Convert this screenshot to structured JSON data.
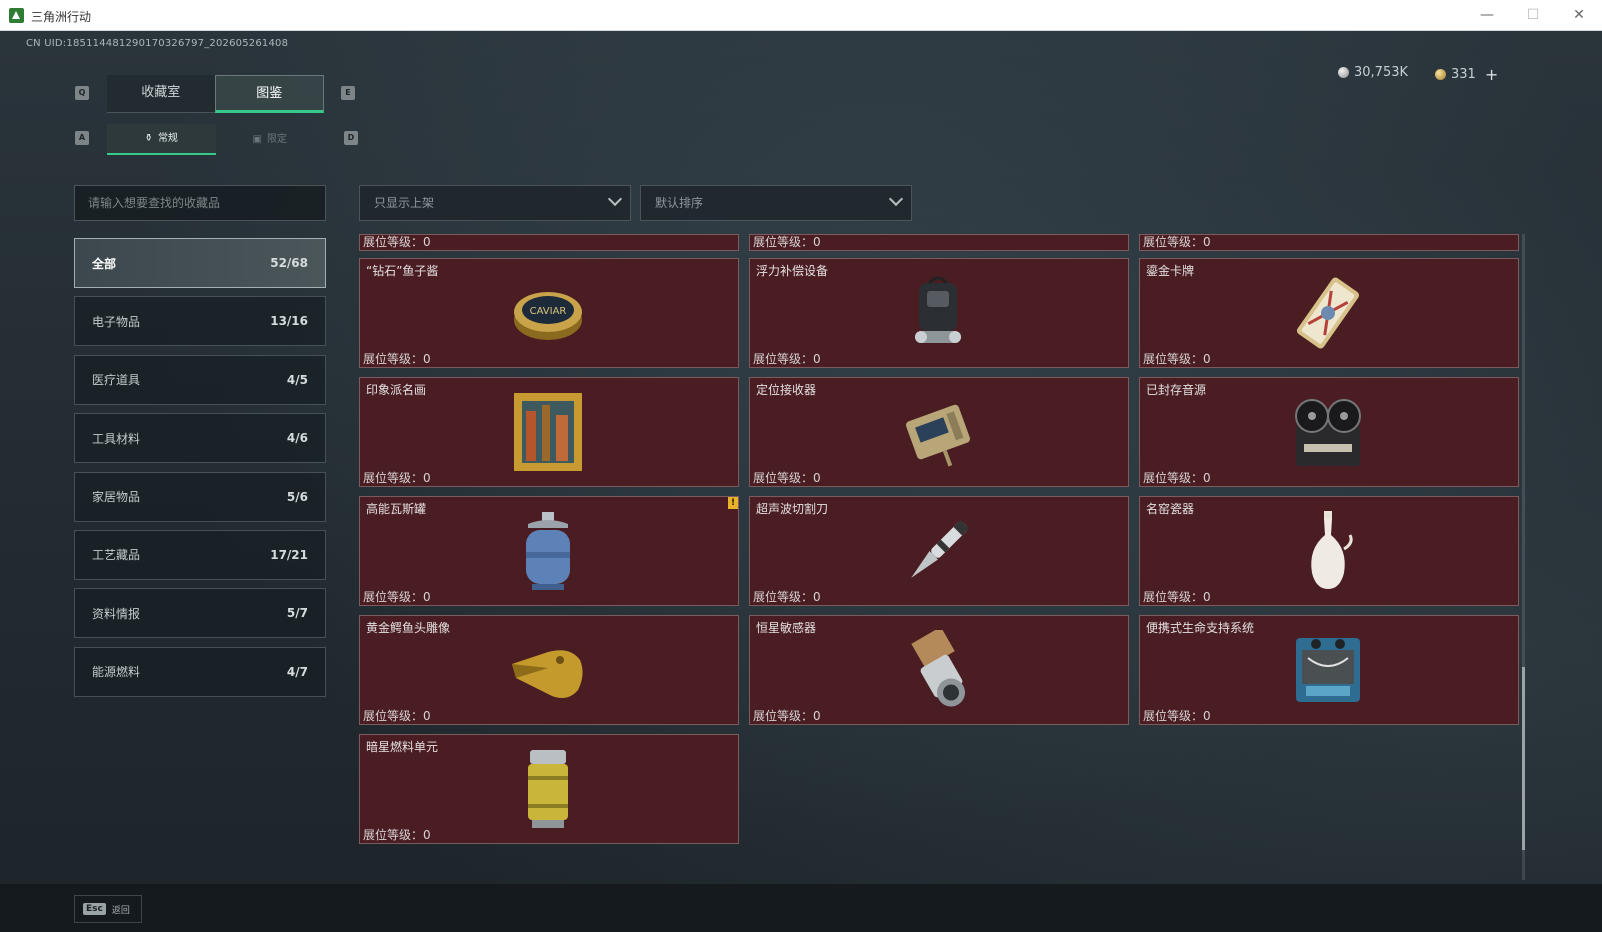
{
  "window": {
    "title": "三角洲行动",
    "minimize_icon": "—",
    "maximize_icon": "☐",
    "close_icon": "✕"
  },
  "header": {
    "uid": "CN UID:1851144812901703267​97_202605261408",
    "currencies": [
      {
        "icon": "silver-coin",
        "value": "30,753K"
      },
      {
        "icon": "gold-coin",
        "value": "331"
      }
    ],
    "plus": "+"
  },
  "key_hints": {
    "tab_prev": "Q",
    "tab_next": "E",
    "sub_prev": "A",
    "sub_next": "D"
  },
  "tabs": [
    {
      "label": "收藏室",
      "active": false
    },
    {
      "label": "图鉴",
      "active": true
    }
  ],
  "subtabs": [
    {
      "label": "常规",
      "icon": "⚱",
      "active": true
    },
    {
      "label": "限定",
      "icon": "▣",
      "active": false
    }
  ],
  "search": {
    "placeholder": "请输入想要查找的收藏品",
    "value": ""
  },
  "filters": [
    {
      "label": "只显示上架"
    },
    {
      "label": "默认排序"
    }
  ],
  "categories": [
    {
      "label": "全部",
      "count": "52/68",
      "active": true
    },
    {
      "label": "电子物品",
      "count": "13/16",
      "active": false
    },
    {
      "label": "医疗道具",
      "count": "4/5",
      "active": false
    },
    {
      "label": "工具材料",
      "count": "4/6",
      "active": false
    },
    {
      "label": "家居物品",
      "count": "5/6",
      "active": false
    },
    {
      "label": "工艺藏品",
      "count": "17/21",
      "active": false
    },
    {
      "label": "资料情报",
      "count": "5/7",
      "active": false
    },
    {
      "label": "能源燃料",
      "count": "4/7",
      "active": false
    }
  ],
  "level_label": "展位等级：",
  "partial_row": [
    {
      "level": "0"
    },
    {
      "level": "0"
    },
    {
      "level": "0"
    }
  ],
  "items": [
    {
      "name": "“钻石”鱼子酱",
      "level": "0",
      "icon": "caviar-tin"
    },
    {
      "name": "浮力补偿设备",
      "level": "0",
      "icon": "buoyancy-device"
    },
    {
      "name": "鎏金卡牌",
      "level": "0",
      "icon": "gilded-card"
    },
    {
      "name": "印象派名画",
      "level": "0",
      "icon": "framed-painting"
    },
    {
      "name": "定位接收器",
      "level": "0",
      "icon": "gps-receiver"
    },
    {
      "name": "已封存音源",
      "level": "0",
      "icon": "reel-recorder"
    },
    {
      "name": "高能瓦斯罐",
      "level": "0",
      "icon": "gas-canister",
      "warning": "!"
    },
    {
      "name": "超声波切割刀",
      "level": "0",
      "icon": "ultrasonic-knife"
    },
    {
      "name": "名窑瓷器",
      "level": "0",
      "icon": "porcelain-vase"
    },
    {
      "name": "黄金鳄鱼头雕像",
      "level": "0",
      "icon": "gold-crocodile-head"
    },
    {
      "name": "恒星敏感器",
      "level": "0",
      "icon": "star-sensor"
    },
    {
      "name": "便携式生命支持系统",
      "level": "0",
      "icon": "life-support-system"
    },
    {
      "name": "暗星燃料单元",
      "level": "0",
      "icon": "fuel-cell"
    }
  ],
  "footer": {
    "esc_key": "Esc",
    "back_label": "返回"
  },
  "colors": {
    "accent": "#37c98b",
    "card_bg": "#4a1d22",
    "warning": "#e8b22a"
  }
}
